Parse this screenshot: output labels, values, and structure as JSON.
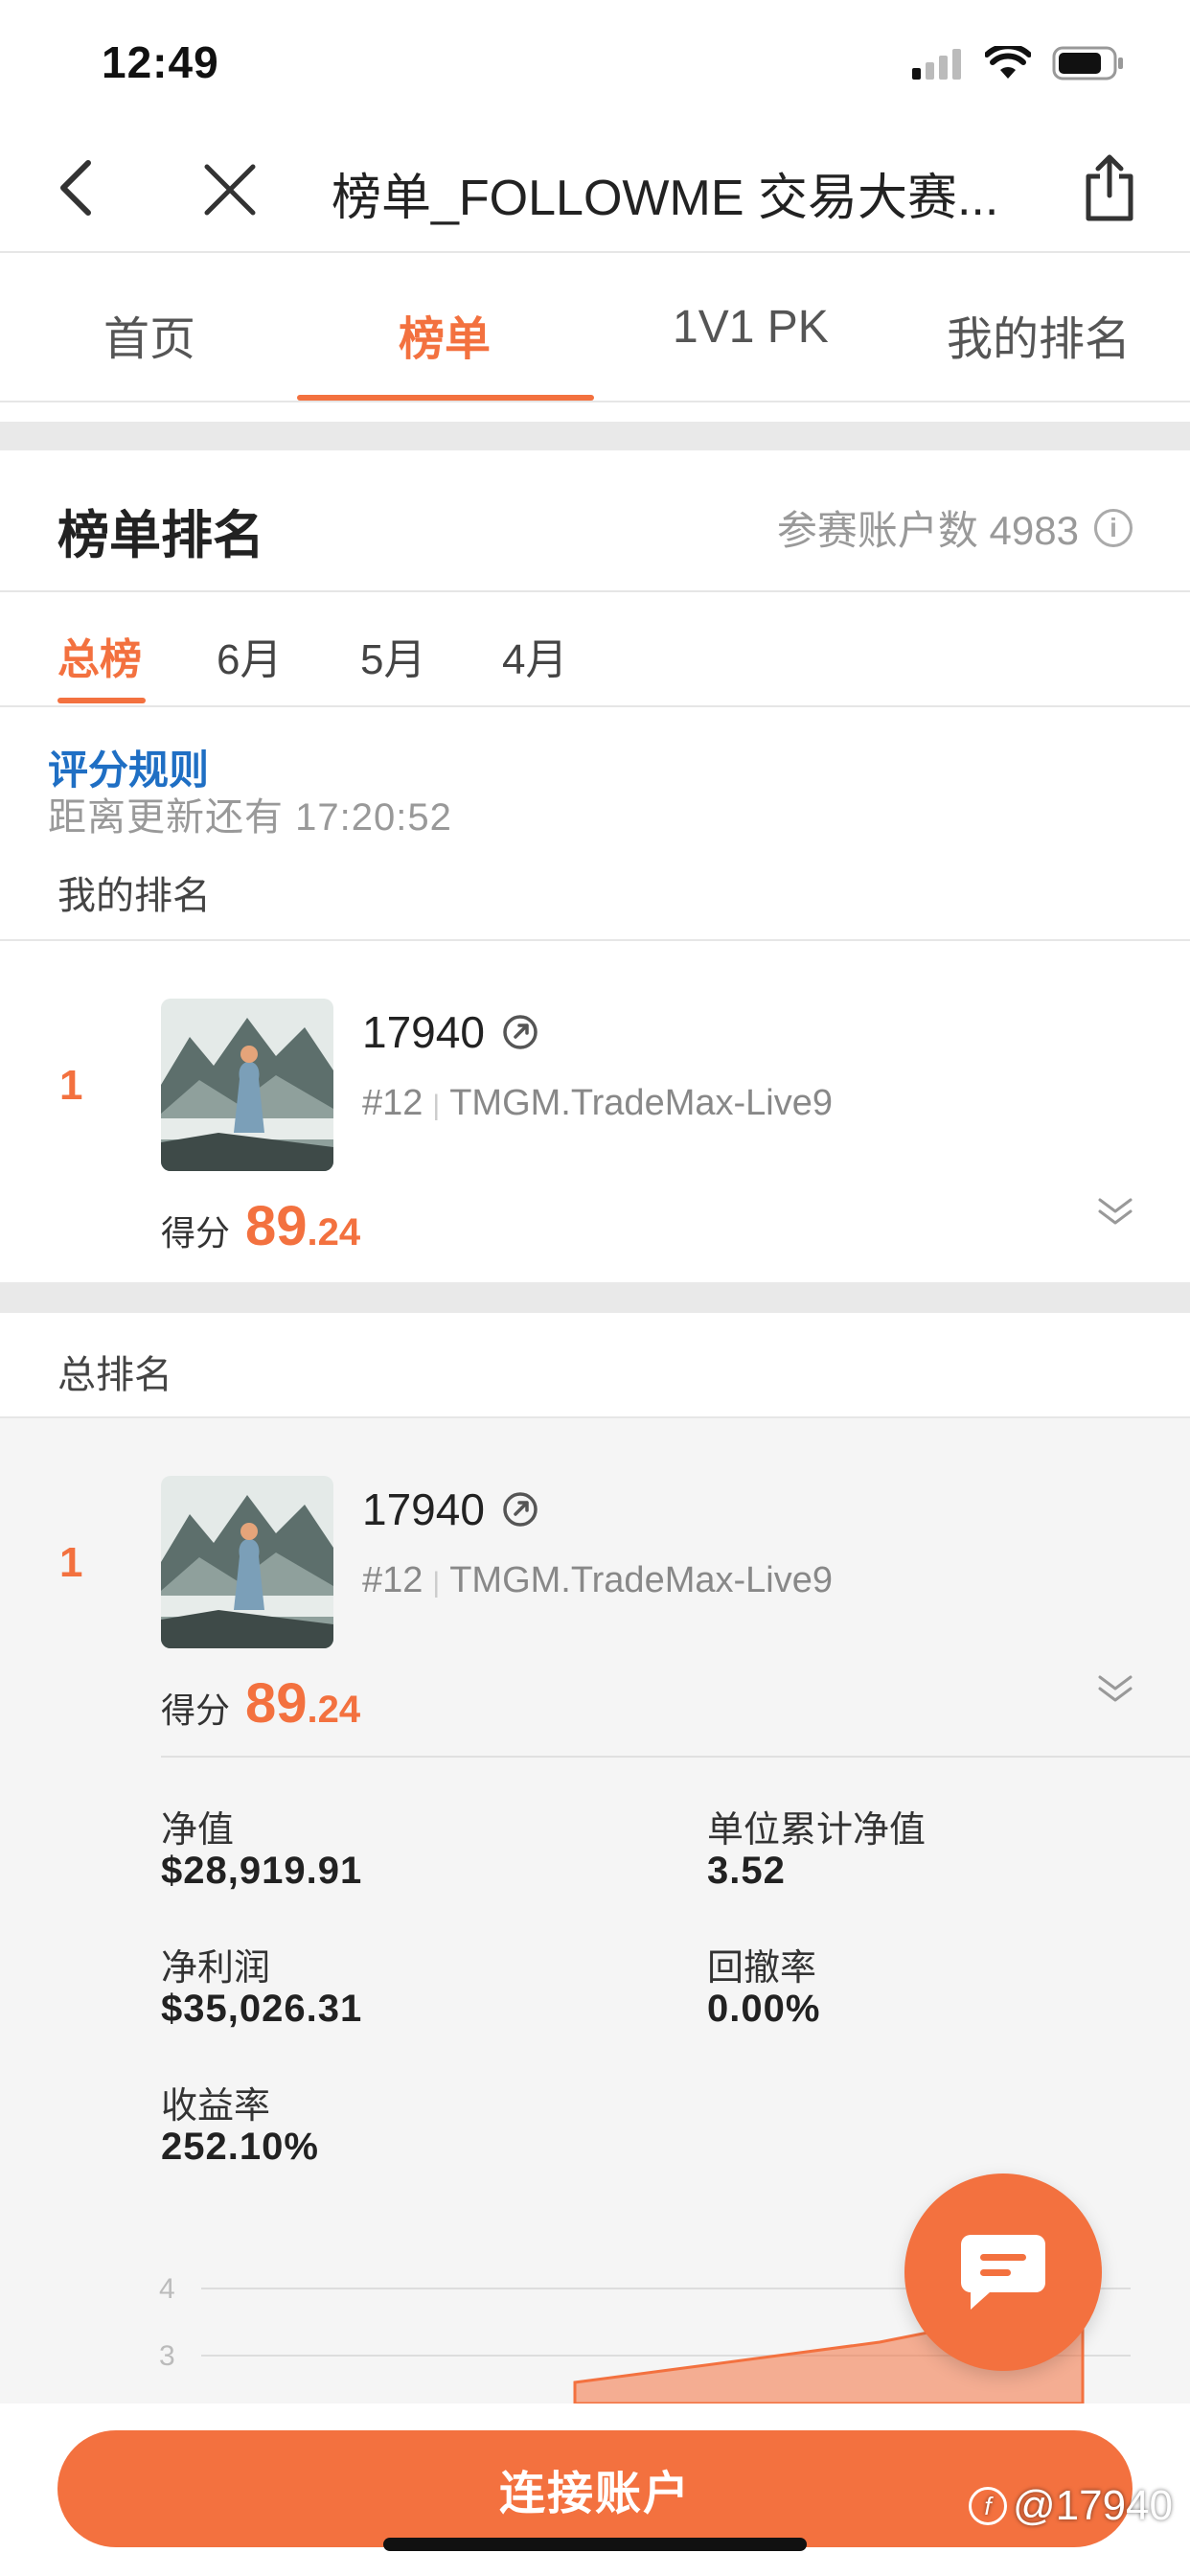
{
  "status_bar": {
    "time": "12:49"
  },
  "nav": {
    "title": "榜单_FOLLOWME 交易大赛..."
  },
  "tabs": [
    {
      "label": "首页"
    },
    {
      "label": "榜单"
    },
    {
      "label": "1V1 PK"
    },
    {
      "label": "我的排名"
    }
  ],
  "section": {
    "title": "榜单排名",
    "participants_label": "参赛账户数 4983"
  },
  "subtabs": [
    {
      "label": "总榜"
    },
    {
      "label": "6月"
    },
    {
      "label": "5月"
    },
    {
      "label": "4月"
    }
  ],
  "rules_link": "评分规则",
  "countdown": "距离更新还有 17:20:52",
  "my_rank_label": "我的排名",
  "total_rank_label": "总排名",
  "my_entry": {
    "rank": "1",
    "username": "17940",
    "account_no": "#12",
    "server": "TMGM.TradeMax-Live9",
    "score_label": "得分",
    "score_int": "89",
    "score_dec": ".24"
  },
  "total_entry": {
    "rank": "1",
    "username": "17940",
    "account_no": "#12",
    "server": "TMGM.TradeMax-Live9",
    "score_label": "得分",
    "score_int": "89",
    "score_dec": ".24",
    "stats": {
      "net_value_label": "净值",
      "net_value": "$28,919.91",
      "unit_nav_label": "单位累计净值",
      "unit_nav": "3.52",
      "net_profit_label": "净利润",
      "net_profit": "$35,026.31",
      "drawdown_label": "回撤率",
      "drawdown": "0.00%",
      "return_label": "收益率",
      "return_rate": "252.10%"
    }
  },
  "chart_data": {
    "type": "area",
    "y_ticks": [
      "4",
      "3"
    ],
    "ylim": [
      2,
      4
    ],
    "series": [
      {
        "values": [
          2.6,
          2.8,
          3.0,
          3.2,
          3.5,
          3.52
        ]
      }
    ]
  },
  "connect_button": "连接账户",
  "watermark": "@17940",
  "colors": {
    "accent": "#f3713f",
    "link": "#1f6fc4"
  }
}
